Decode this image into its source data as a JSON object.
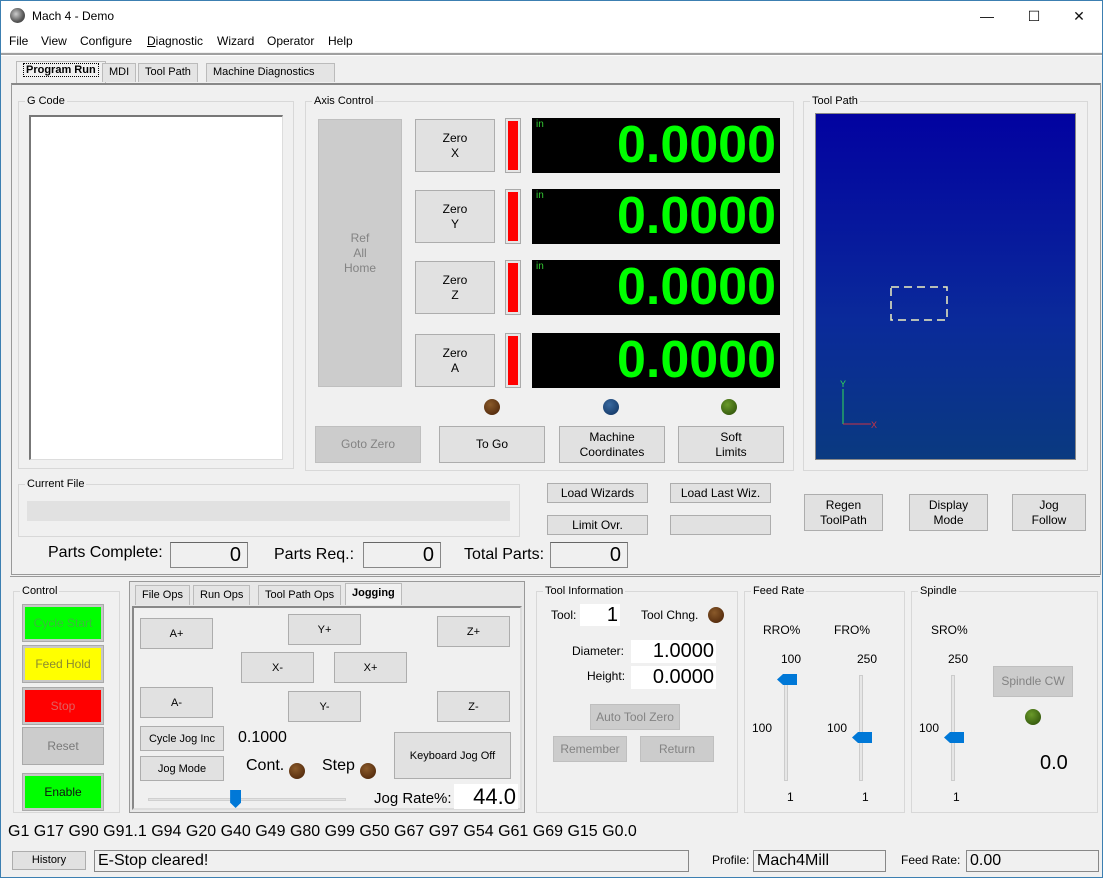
{
  "window": {
    "title": "Mach 4 - Demo",
    "controls": {
      "minimize": "—",
      "maximize": "☐",
      "close": "✕"
    }
  },
  "menu": {
    "items": [
      "File",
      "View",
      "Configure",
      "Diagnostic",
      "Wizard",
      "Operator",
      "Help"
    ]
  },
  "tabs": [
    {
      "label": "Program Run",
      "active": true
    },
    {
      "label": "MDI",
      "active": false
    },
    {
      "label": "Tool Path",
      "active": false
    },
    {
      "label": "Machine Diagnostics",
      "active": false
    }
  ],
  "gcode": {
    "legend": "G Code",
    "content": ""
  },
  "axis_control": {
    "legend": "Axis Control",
    "ref_all_home": "Ref\nAll\nHome",
    "axes": [
      {
        "zero_label": "Zero\nX",
        "unit": "in",
        "value": "0.0000"
      },
      {
        "zero_label": "Zero\nY",
        "unit": "in",
        "value": "0.0000"
      },
      {
        "zero_label": "Zero\nZ",
        "unit": "in",
        "value": "0.0000"
      },
      {
        "zero_label": "Zero\nA",
        "unit": "",
        "value": "0.0000"
      }
    ],
    "leds": [
      "brown",
      "blue",
      "green"
    ],
    "goto_zero": "Goto Zero",
    "to_go": "To Go",
    "machine_coordinates": "Machine\nCoordinates",
    "soft_limits": "Soft\nLimits"
  },
  "toolpath": {
    "legend": "Tool Path",
    "axis_x": "X",
    "axis_y": "Y",
    "regen": "Regen\nToolPath",
    "display_mode": "Display\nMode",
    "jog_follow": "Jog\nFollow"
  },
  "current_file": {
    "legend": "Current File",
    "value": ""
  },
  "wizards": {
    "load_wizards": "Load Wizards",
    "load_last_wiz": "Load Last Wiz.",
    "limit_ovr": "Limit Ovr.",
    "blank": ""
  },
  "parts": {
    "complete_label": "Parts Complete:",
    "complete_value": "0",
    "req_label": "Parts Req.:",
    "req_value": "0",
    "total_label": "Total Parts:",
    "total_value": "0"
  },
  "control": {
    "legend": "Control",
    "cycle_start": "Cycle Start",
    "feed_hold": "Feed Hold",
    "stop": "Stop",
    "reset": "Reset",
    "enable": "Enable",
    "colors": {
      "cycle_start": "#00ff00",
      "feed_hold": "#ffff00",
      "stop": "#ff0000",
      "reset": "#cccccc",
      "enable": "#00ff00"
    }
  },
  "subtabs": [
    {
      "label": "File Ops",
      "active": false
    },
    {
      "label": "Run Ops",
      "active": false
    },
    {
      "label": "Tool Path Ops",
      "active": false
    },
    {
      "label": "Jogging",
      "active": true
    }
  ],
  "jogging": {
    "a_plus": "A+",
    "y_plus": "Y+",
    "z_plus": "Z+",
    "x_minus": "X-",
    "x_plus": "X+",
    "a_minus": "A-",
    "y_minus": "Y-",
    "z_minus": "Z-",
    "cycle_jog_inc": "Cycle Jog Inc",
    "jog_inc_value": "0.1000",
    "jog_mode": "Jog Mode",
    "cont_label": "Cont.",
    "step_label": "Step",
    "keyboard_jog": "Keyboard Jog Off",
    "jog_rate_label": "Jog Rate%:",
    "jog_rate_value": "44.0",
    "jog_rate_slider_fraction": 0.44
  },
  "tool_info": {
    "legend": "Tool Information",
    "tool_label": "Tool:",
    "tool_value": "1",
    "tool_change_label": "Tool Chng.",
    "diameter_label": "Diameter:",
    "diameter_value": "1.0000",
    "height_label": "Height:",
    "height_value": "0.0000",
    "auto_tool_zero": "Auto Tool Zero",
    "remember": "Remember",
    "return": "Return"
  },
  "feed_rate": {
    "legend": "Feed Rate",
    "rro": {
      "label": "RRO%",
      "max": "100",
      "mid": "100",
      "min": "1",
      "value": 100
    },
    "fro": {
      "label": "FRO%",
      "max": "250",
      "mid": "100",
      "min": "1",
      "value": 100
    }
  },
  "spindle": {
    "legend": "Spindle",
    "sro": {
      "label": "SRO%",
      "max": "250",
      "mid": "100",
      "min": "1",
      "value": 100
    },
    "spindle_cw": "Spindle CW",
    "speed": "0.0"
  },
  "status": {
    "gcode_modes": "G1 G17 G90 G91.1 G94 G20 G40 G49 G80 G99 G50 G67 G97 G54 G61 G69 G15 G0.0",
    "history": "History",
    "message": "E-Stop cleared!",
    "profile_label": "Profile:",
    "profile_value": "Mach4Mill",
    "feed_rate_label": "Feed Rate:",
    "feed_rate_value": "0.00"
  }
}
